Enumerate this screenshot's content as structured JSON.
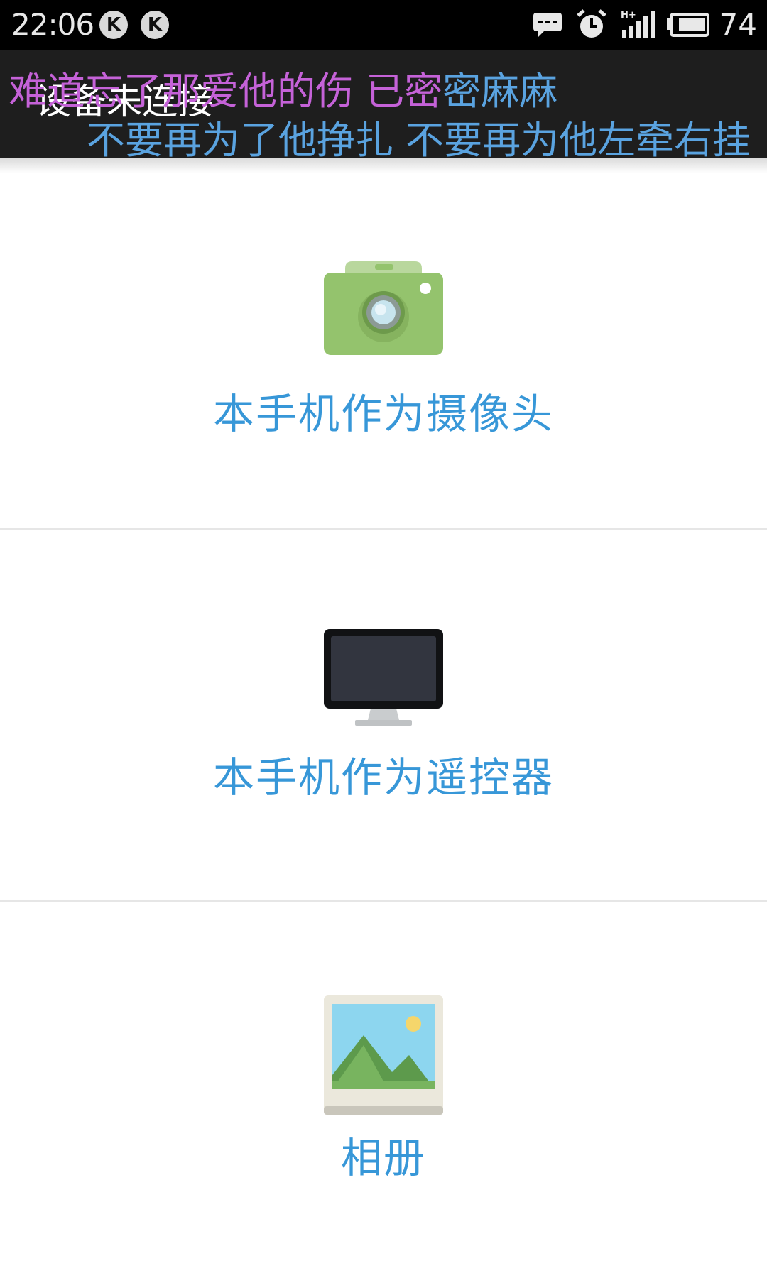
{
  "status_bar": {
    "time": "22:06",
    "app_icons": [
      "K",
      "K"
    ],
    "right_icons": [
      "message-icon",
      "alarm-icon",
      "signal-icon",
      "battery-icon"
    ],
    "signal_type": "H+",
    "battery": "74"
  },
  "title_bar": {
    "title": "设备未连接",
    "lyric_line_1_a": "难道忘了那爱他的伤 已密",
    "lyric_line_1_b": "密麻麻",
    "lyric_line_2": "不要再为了他挣扎 不要再为他左牵右挂"
  },
  "menu": {
    "items": [
      {
        "label": "本手机作为摄像头",
        "icon": "camera-icon"
      },
      {
        "label": "本手机作为遥控器",
        "icon": "monitor-icon"
      },
      {
        "label": "相册",
        "icon": "photo-album-icon"
      }
    ]
  },
  "colors": {
    "accent": "#3797d8",
    "lyric_purple": "#c562d8",
    "lyric_blue": "#5aa3e0",
    "title_bar_bg": "#1e1e1e",
    "camera_green": "#94c36d"
  }
}
